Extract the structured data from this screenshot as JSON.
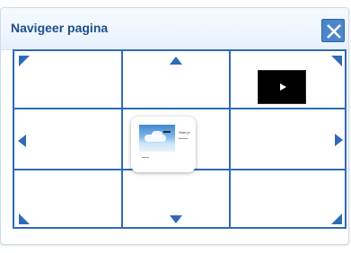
{
  "dialog": {
    "title": "Navigeer pagina",
    "close_icon": "close-icon"
  },
  "thumbnail": {
    "caption": "Start je"
  },
  "colors": {
    "accent": "#2f6ab8",
    "title": "#1f4e8c",
    "close_button": "#4a86cc"
  }
}
